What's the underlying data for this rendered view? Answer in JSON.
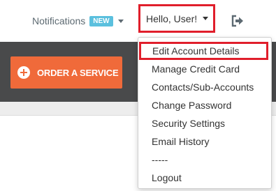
{
  "topbar": {
    "notifications_label": "Notifications",
    "notifications_badge": "NEW",
    "user_greeting": "Hello, User!"
  },
  "hero": {
    "order_button_label": "ORDER A SERVICE"
  },
  "account_menu": {
    "items": [
      {
        "label": "Edit Account Details",
        "highlighted": true
      },
      {
        "label": "Manage Credit Card"
      },
      {
        "label": "Contacts/Sub-Accounts"
      },
      {
        "label": "Change Password"
      },
      {
        "label": "Security Settings"
      },
      {
        "label": "Email History"
      },
      {
        "label": "-----"
      },
      {
        "label": "Logout"
      }
    ]
  },
  "icons": {
    "logout": "logout-icon",
    "order": "plus-circle-icon",
    "dropdown": "caret-down-icon"
  },
  "colors": {
    "accent_orange": "#f06a3a",
    "badge_blue": "#5bc0de",
    "highlight_red": "#e01e2b",
    "dark_bar": "#494a4b"
  }
}
